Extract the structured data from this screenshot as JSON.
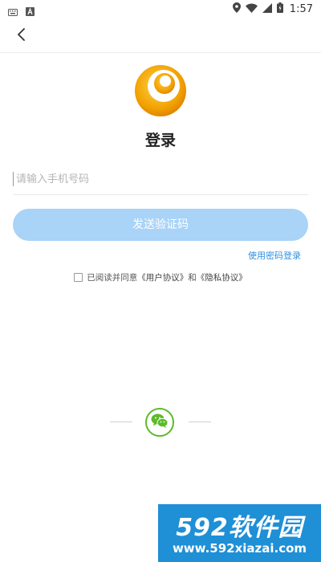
{
  "status_bar": {
    "time": "1:57",
    "icons": [
      "keyboard-icon",
      "text-a-icon",
      "location-icon",
      "wifi-icon",
      "signal-icon",
      "battery-icon"
    ]
  },
  "nav": {
    "back_icon": "chevron-left-icon"
  },
  "title": "登录",
  "phone_input": {
    "placeholder": "请输入手机号码",
    "value": ""
  },
  "send_code_button": "发送验证码",
  "password_login_link": "使用密码登录",
  "agreement": {
    "prefix": "已阅读并同意",
    "user_agreement": "《用户协议》",
    "and": "和",
    "privacy_agreement": "《隐私协议》"
  },
  "third_party": {
    "wechat_icon": "wechat-icon"
  },
  "watermark": {
    "brand": "592软件园",
    "url": "www.592xiazai.com"
  },
  "colors": {
    "primary_button": "#a9d3f7",
    "link": "#2f8fe0",
    "wechat": "#5cba2b",
    "logo_orange": "#f0a000",
    "watermark_bg": "#1f8fd6"
  }
}
